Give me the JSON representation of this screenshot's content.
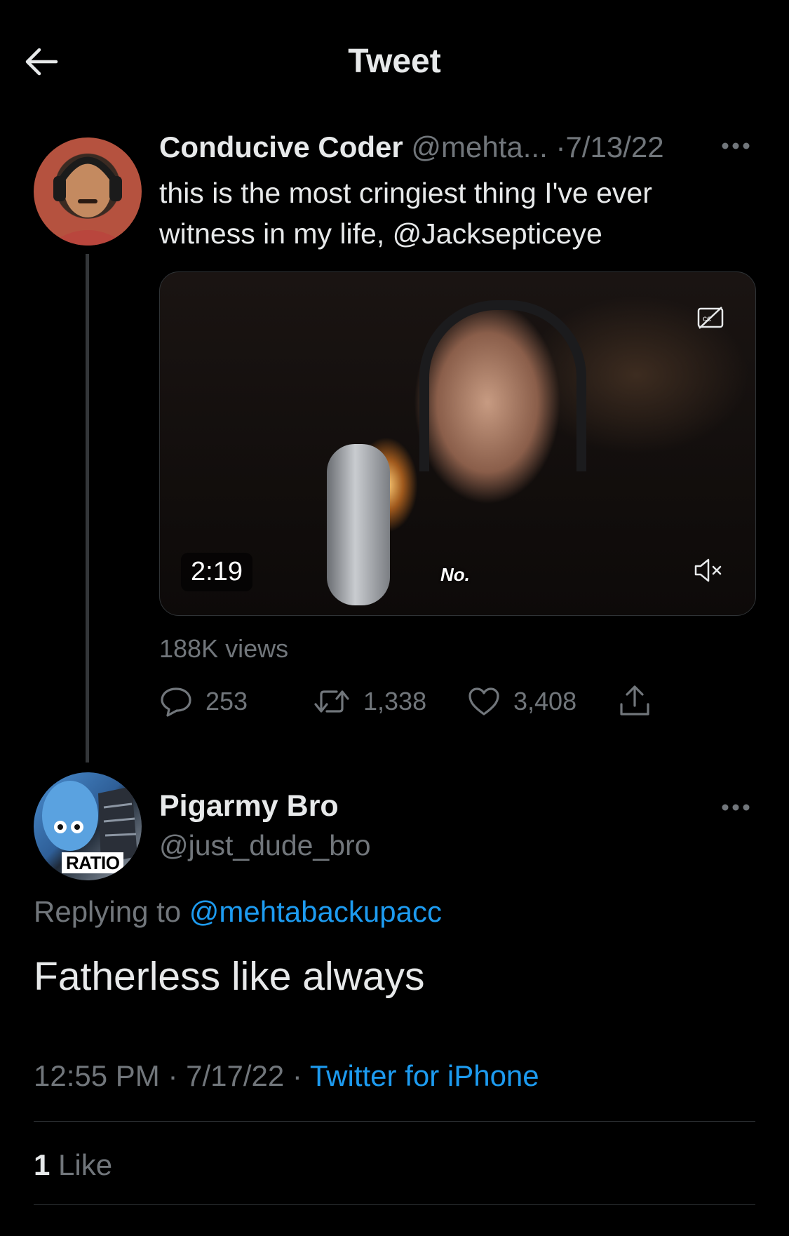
{
  "header": {
    "title": "Tweet"
  },
  "tweet1": {
    "name": "Conducive Coder",
    "handle": "@mehta...",
    "separator": "·",
    "date": "7/13/22",
    "text": "this is the most cringiest thing I've ever witness in my life, @Jacksepticeye",
    "media": {
      "duration": "2:19",
      "caption": "No."
    },
    "views": "188K views",
    "replies": "253",
    "retweets": "1,338",
    "likes": "3,408"
  },
  "tweet2": {
    "name": "Pigarmy Bro",
    "handle": "@just_dude_bro",
    "avatar_tag": "RATIO",
    "replying_prefix": "Replying to ",
    "replying_to": "@mehtabackupacc",
    "text": "Fatherless like always",
    "time": "12:55 PM",
    "meta_separator": " · ",
    "date": "7/17/22",
    "source": "Twitter for iPhone",
    "like_count": "1",
    "like_label": " Like"
  },
  "colors": {
    "background": "#000000",
    "text": "#e7e9ea",
    "muted": "#71767b",
    "link": "#1d9bf0",
    "divider": "#2f3336"
  },
  "icons": [
    "back-arrow-icon",
    "more-icon",
    "closed-caption-icon",
    "mute-icon",
    "reply-icon",
    "retweet-icon",
    "like-icon",
    "share-icon"
  ]
}
